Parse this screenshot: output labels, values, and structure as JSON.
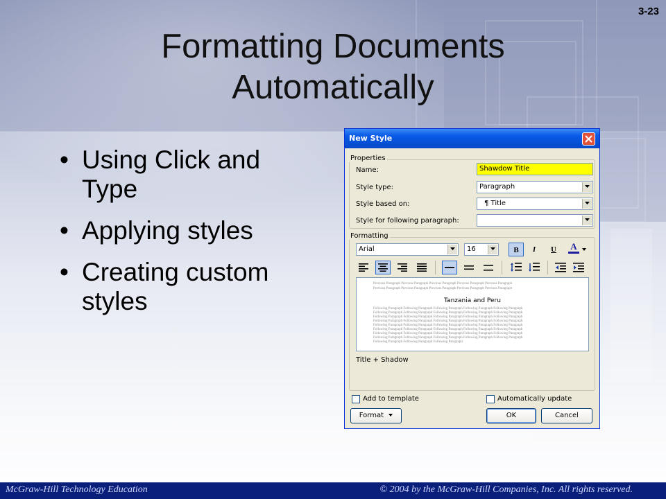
{
  "slide": {
    "number": "3-23",
    "title_line1": "Formatting Documents",
    "title_line2": "Automatically",
    "bullets": [
      {
        "line1": "Using Click and",
        "line2": "Type"
      },
      {
        "line1": "Applying styles",
        "line2": ""
      },
      {
        "line1": "Creating custom",
        "line2": "styles"
      }
    ],
    "footer_left": "McGraw-Hill Technology Education",
    "footer_right": "© 2004 by the McGraw-Hill Companies, Inc.  All rights reserved.",
    "bullet_char": "•"
  },
  "dialog": {
    "title": "New Style",
    "properties_label": "Properties",
    "name_label": "Name:",
    "name_value": "Shawdow Title",
    "style_type_label": "Style type:",
    "style_type_value": "Paragraph",
    "based_on_label": "Style based on:",
    "based_on_value": "¶ Title",
    "following_label": "Style for following paragraph:",
    "following_value": "",
    "formatting_label": "Formatting",
    "font_value": "Arial",
    "size_value": "16",
    "bold_label": "B",
    "italic_label": "I",
    "underline_label": "U",
    "font_color_label": "A",
    "preview_title": "Tanzania and Peru",
    "preview_previous": "Previous Paragraph Previous Paragraph Previous Paragraph Previous Paragraph Previous Paragraph",
    "preview_following": "Following Paragraph Following Paragraph Following Paragraph Following Paragraph Following Paragraph",
    "preview_following_last": "Following Paragraph Following Paragraph Following Paragraph",
    "description": "Title + Shadow",
    "add_to_template": "Add to template",
    "auto_update": "Automatically update",
    "format_button": "Format",
    "ok_button": "OK",
    "cancel_button": "Cancel",
    "colors": {
      "titlebar": "#0a5ae6",
      "name_highlight": "#ffff00",
      "close": "#e1523b"
    }
  }
}
